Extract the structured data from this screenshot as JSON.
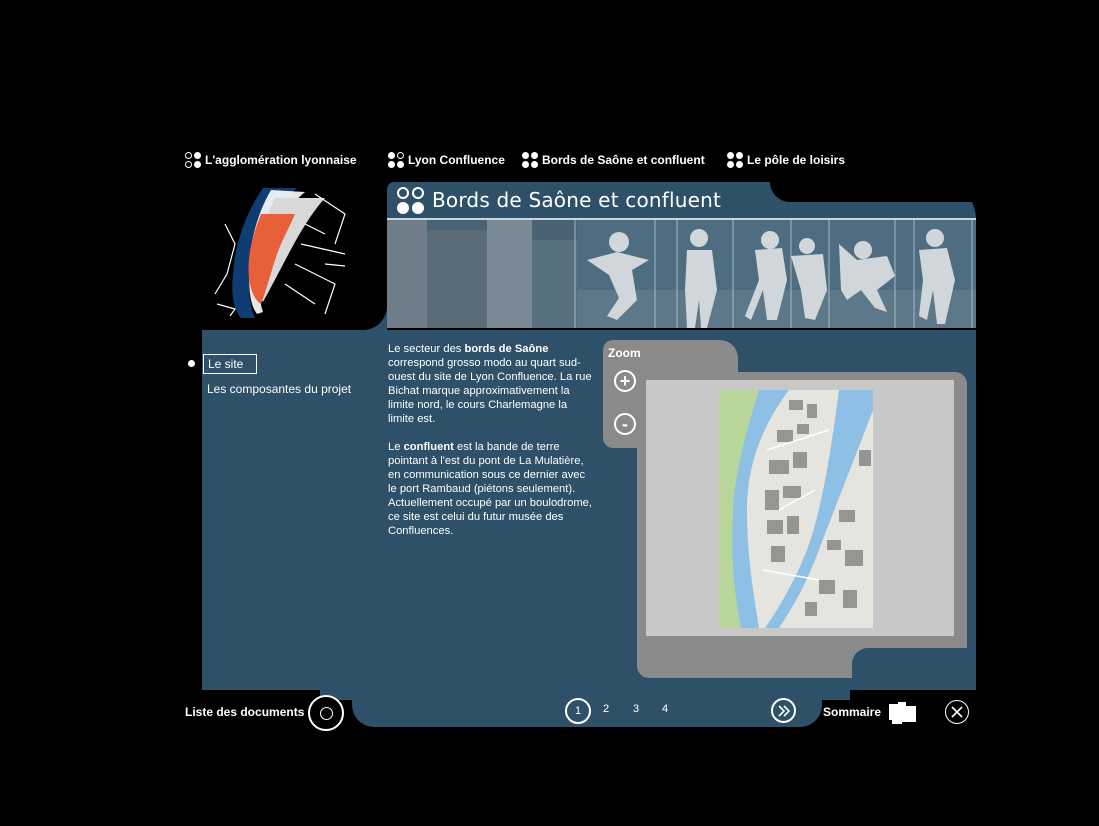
{
  "nav": [
    {
      "label": "L'agglomération lyonnaise",
      "dots": [
        "o",
        "f",
        "o",
        "f"
      ]
    },
    {
      "label": "Lyon Confluence",
      "dots": [
        "f",
        "o",
        "f",
        "f"
      ]
    },
    {
      "label": "Bords de Saône et confluent",
      "dots": [
        "f",
        "f",
        "f",
        "f"
      ]
    },
    {
      "label": "Le pôle de loisirs",
      "dots": [
        "f",
        "f",
        "f",
        "f"
      ]
    }
  ],
  "header": {
    "title": "Bords de Saône et confluent"
  },
  "sidebar": {
    "items": [
      {
        "label": "Le site",
        "active": true
      },
      {
        "label": "Les composantes du projet",
        "active": false
      }
    ]
  },
  "content": {
    "p1_a": "Le secteur des ",
    "p1_b": "bords de Saône",
    "p1_c": " correspond grosso modo au quart sud-ouest du site de Lyon Confluence. La rue Bichat marque approximativement la limite nord, le cours Charlemagne la limite est.",
    "p2_a": "Le ",
    "p2_b": "confluent",
    "p2_c": " est la bande de terre pointant à l'est du pont de La Mulatière, en communication sous ce dernier avec le port Rambaud (piétons seulement). Actuellement occupé par un boulodrome, ce site est celui du futur musée des Confluences."
  },
  "zoom": {
    "label": "Zoom",
    "in": "+",
    "out": "-"
  },
  "footer": {
    "documents": "Liste des documents",
    "pages": [
      "1",
      "2",
      "3",
      "4"
    ],
    "current_page": "1",
    "summary": "Sommaire"
  },
  "colors": {
    "panel": "#2e5068",
    "accent_orange": "#e8603a",
    "river": "#0f3c73",
    "zoom_frame": "#8a8a8a"
  }
}
